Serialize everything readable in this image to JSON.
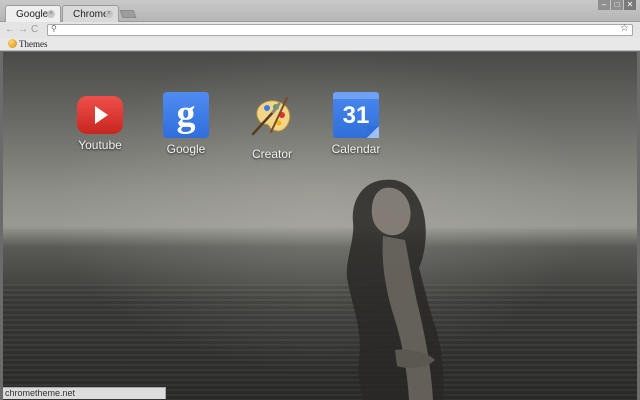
{
  "tabs": [
    {
      "label": "Google"
    },
    {
      "label": "Chrome"
    }
  ],
  "window_controls": [
    "–",
    "□",
    "✕"
  ],
  "toolbar": {
    "back": "←",
    "forward": "→",
    "reload": "C",
    "omnibox_value": "",
    "star": "☆",
    "search_icon": "search-icon"
  },
  "bookmarks": [
    {
      "label": "Themes",
      "icon": "themes-icon"
    }
  ],
  "apps": [
    {
      "label": "Youtube",
      "icon": "youtube-icon"
    },
    {
      "label": "Google",
      "icon": "google-icon",
      "glyph": "g"
    },
    {
      "label": "Creator",
      "icon": "palette-icon"
    },
    {
      "label": "Calendar",
      "icon": "calendar-icon",
      "glyph": "31"
    }
  ],
  "status_bar": "chrometheme.net",
  "colors": {
    "youtube_red": "#e0312a",
    "google_blue": "#3b7be6",
    "calendar_blue": "#3a7ce6"
  }
}
